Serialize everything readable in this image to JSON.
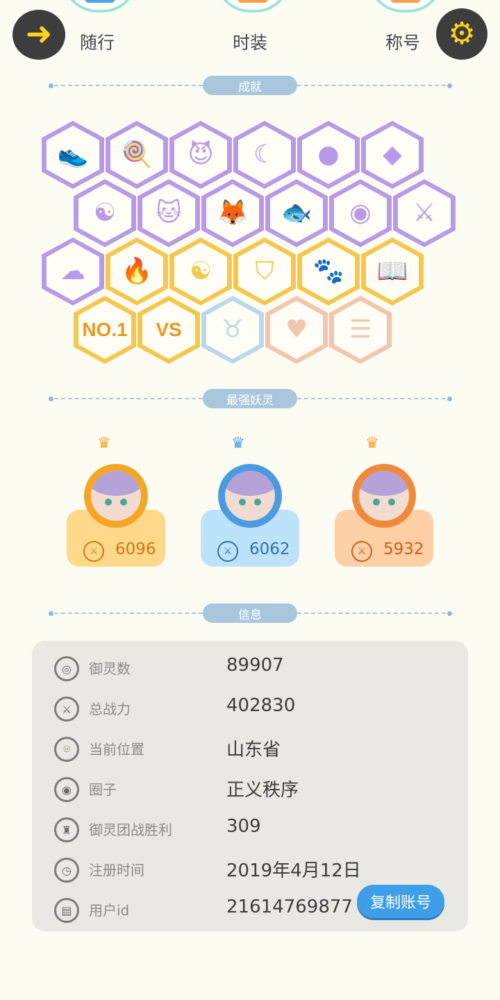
{
  "nav": {
    "back_icon": "arrow-left-icon",
    "settings_icon": "gear-icon",
    "tabs": [
      {
        "label": "随行",
        "color": "#4fa3e8"
      },
      {
        "label": "时装",
        "color": "#f5a04a"
      },
      {
        "label": "称号",
        "color": "#f5a04a"
      }
    ]
  },
  "sections": {
    "achievements": "成就",
    "top_spirits": "最强妖灵",
    "info": "信息"
  },
  "achievements": {
    "rows": [
      [
        {
          "icon": "sneaker-icon",
          "tier": "purple"
        },
        {
          "icon": "lollipop-icon",
          "tier": "purple"
        },
        {
          "icon": "devil-face-icon",
          "tier": "purple"
        },
        {
          "icon": "moon-icon",
          "tier": "purple"
        },
        {
          "icon": "orb-icon",
          "tier": "purple"
        },
        {
          "icon": "crystal-icon",
          "tier": "purple"
        }
      ],
      [
        {
          "icon": "yin-yang-comet-icon",
          "tier": "purple"
        },
        {
          "icon": "cart-cat-icon",
          "tier": "purple"
        },
        {
          "icon": "fox-spirit-icon",
          "tier": "purple"
        },
        {
          "icon": "fish-crown-icon",
          "tier": "purple"
        },
        {
          "icon": "emblem-icon",
          "tier": "purple"
        },
        {
          "icon": "crossed-swords-icon",
          "tier": "purple"
        }
      ],
      [
        {
          "icon": "angry-blob-icon",
          "tier": "purple"
        },
        {
          "icon": "fire-spirit-icon",
          "tier": "gold"
        },
        {
          "icon": "yin-yang-book-icon",
          "tier": "gold"
        },
        {
          "icon": "shield-icon",
          "tier": "gold"
        },
        {
          "icon": "cat-pair-icon",
          "tier": "gold"
        },
        {
          "icon": "open-book-icon",
          "tier": "gold"
        }
      ],
      [
        {
          "icon": "no1-icon",
          "tier": "gold",
          "text": "NO.1"
        },
        {
          "icon": "versus-icon",
          "tier": "gold",
          "text": "VS"
        },
        {
          "icon": "horned-statue-icon",
          "tier": "blue"
        },
        {
          "icon": "twin-cats-icon",
          "tier": "peach"
        },
        {
          "icon": "cat-list-icon",
          "tier": "peach"
        }
      ]
    ],
    "tier_colors": {
      "purple": "#b89be6",
      "gold": "#f4c84e",
      "blue": "#b9d8ec",
      "peach": "#f2c5ac"
    }
  },
  "top_spirits": [
    {
      "rank": 1,
      "power": "6096",
      "card_color": "#ffd88a",
      "ring_color": "#f5a623",
      "crown_color": "#f5a623",
      "text_color": "#c77a1a"
    },
    {
      "rank": 2,
      "power": "6062",
      "card_color": "#bfe2fb",
      "ring_color": "#4a9be0",
      "crown_color": "#4a9be0",
      "text_color": "#2f6fb0"
    },
    {
      "rank": 3,
      "power": "5932",
      "card_color": "#ffcfa5",
      "ring_color": "#ef8a3b",
      "crown_color": "#f5a623",
      "text_color": "#c85f1a"
    }
  ],
  "info": {
    "rows": [
      {
        "icon": "spirit-icon",
        "label": "御灵数",
        "value": "89907"
      },
      {
        "icon": "sword-icon",
        "label": "总战力",
        "value": "402830"
      },
      {
        "icon": "location-pin-icon",
        "label": "当前位置",
        "value": "山东省"
      },
      {
        "icon": "circle-target-icon",
        "label": "圈子",
        "value": "正义秩序"
      },
      {
        "icon": "trophy-icon",
        "label": "御灵团战胜利",
        "value": "309"
      },
      {
        "icon": "clock-icon",
        "label": "注册时间",
        "value": "2019年4月12日"
      },
      {
        "icon": "id-card-icon",
        "label": "用户id",
        "value": "21614769877"
      }
    ],
    "copy_button": "复制账号"
  }
}
